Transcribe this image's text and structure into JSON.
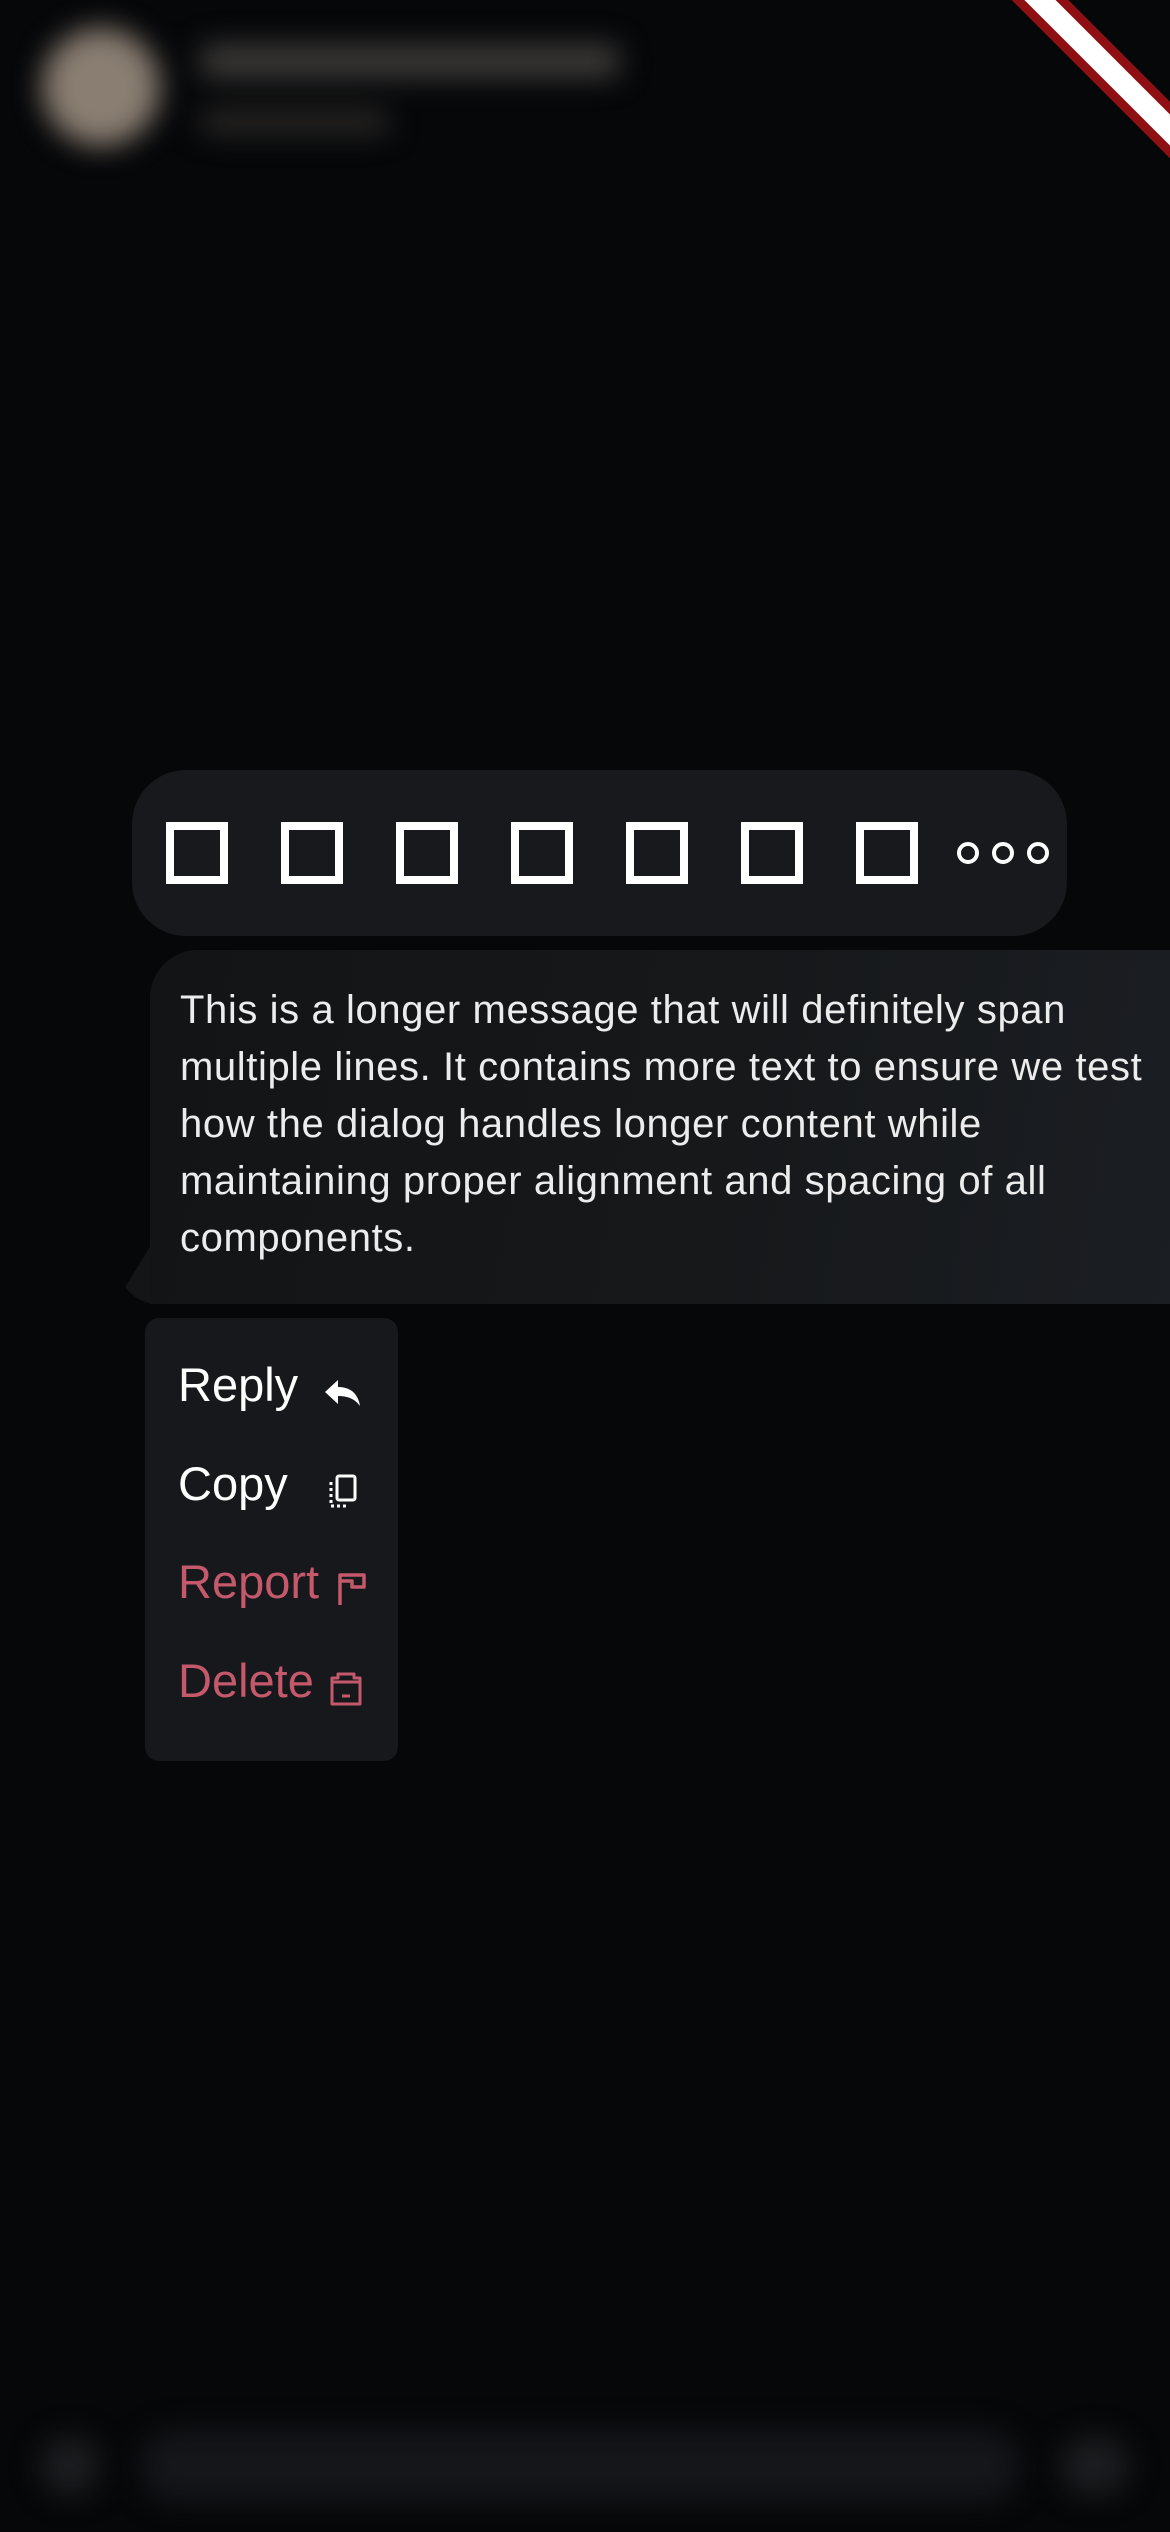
{
  "colors": {
    "background": "#060709",
    "surface": "#17191c",
    "text": "#ffffff",
    "danger": "#c3596b"
  },
  "reactions": {
    "items": [
      "□",
      "□",
      "□",
      "□",
      "□",
      "□",
      "□"
    ],
    "more_icon": "more-horizontal-icon"
  },
  "message": {
    "text": "This is a longer message that will definitely span multiple lines. It contains more text to ensure we test how the dialog handles longer content while maintaining proper alignment and spacing of all components."
  },
  "menu": {
    "items": [
      {
        "label": "Reply",
        "icon": "reply-icon",
        "danger": false
      },
      {
        "label": "Copy",
        "icon": "copy-icon",
        "danger": false
      },
      {
        "label": "Report",
        "icon": "flag-icon",
        "danger": true
      },
      {
        "label": "Delete",
        "icon": "trash-icon",
        "danger": true
      }
    ]
  }
}
